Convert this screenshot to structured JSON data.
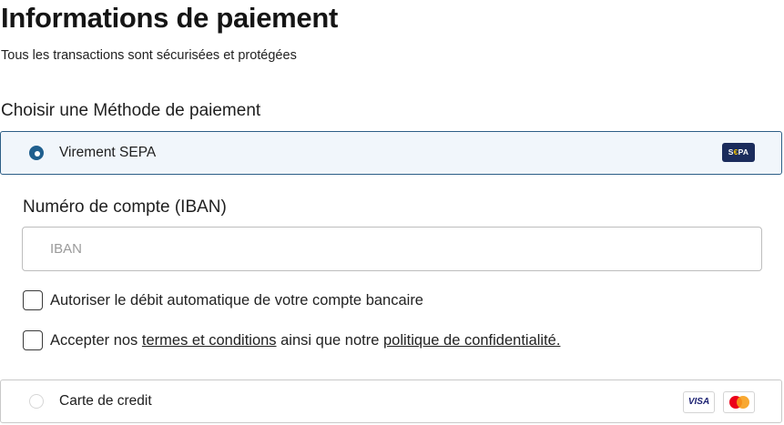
{
  "header": {
    "title": "Informations de paiement",
    "subtitle": "Tous les transactions sont sécurisées et protégées"
  },
  "payment": {
    "section_label": "Choisir une Méthode de paiement",
    "methods": [
      {
        "label": "Virement SEPA",
        "selected": true,
        "logo_text_s": "S",
        "logo_text_e": "€",
        "logo_text_pa": "PA"
      },
      {
        "label": "Carte de credit",
        "selected": false,
        "visa_text": "VISA"
      }
    ]
  },
  "sepa_form": {
    "iban_label": "Numéro de compte (IBAN)",
    "iban_placeholder": "IBAN",
    "iban_value": "",
    "checkbox_autodebit": {
      "label": "Autoriser le débit automatique de votre compte bancaire",
      "checked": false
    },
    "checkbox_terms": {
      "prefix": "Accepter nos ",
      "terms_link": "termes et conditions",
      "middle": " ainsi que notre ",
      "privacy_link": "politique de confidentialité.",
      "checked": false
    }
  },
  "colors": {
    "accent": "#1f5f8e",
    "selected_border": "#2d5e86",
    "selected_bg": "#f1f6fb",
    "sepa_logo_bg": "#1b2c5c"
  },
  "icons": [
    "radio-selected-icon",
    "radio-unselected-icon",
    "sepa-logo-icon",
    "visa-logo-icon",
    "mastercard-logo-icon"
  ]
}
